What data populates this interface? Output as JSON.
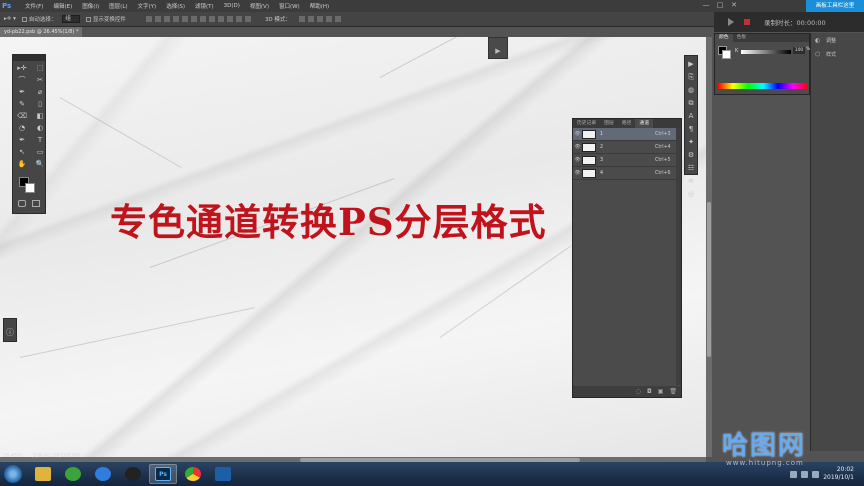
{
  "app": {
    "logo": "Ps",
    "banner": "画板工具栏这里"
  },
  "menu": [
    "文件(F)",
    "编辑(E)",
    "图像(I)",
    "图层(L)",
    "文字(Y)",
    "选择(S)",
    "滤镜(T)",
    "3D(D)",
    "视图(V)",
    "窗口(W)",
    "帮助(H)"
  ],
  "window_controls": {
    "minimize": "—",
    "maximize": "□",
    "close": "✕"
  },
  "options": {
    "auto_select_label": "自动选择：",
    "auto_select_value": "组",
    "show_transform_label": "显示变换控件",
    "mode_3d": "3D 模式："
  },
  "recorder": {
    "label": "录制时长：00:00:00"
  },
  "document": {
    "tab_title": "yd-pb22.psb @ 26.45%(1/8) * ×"
  },
  "canvas": {
    "headline": "专色通道转换PS分层格式",
    "cursor": "↔"
  },
  "status": {
    "zoom": "26.45%",
    "doc": "文档:40.2M/168.8M"
  },
  "tools": [
    "▸✛",
    "⬚",
    "⌒",
    "✂",
    "✒",
    "⌀",
    "✎",
    "▯",
    "⌫",
    "◧",
    "◔",
    "◐",
    "✒",
    "T",
    "↖",
    "▭",
    "✋",
    "🔍"
  ],
  "side_strip": [
    "▶",
    "⎘",
    "◍",
    "⧉",
    "A",
    "¶",
    "✦",
    "⚙",
    "☷",
    "≋",
    "◎"
  ],
  "channels": {
    "tabs": [
      "历史记录",
      "图层",
      "路径",
      "通道"
    ],
    "active_tab": "通道",
    "rows": [
      {
        "name": "1",
        "key": "Ctrl+3",
        "selected": true
      },
      {
        "name": "2",
        "key": "Ctrl+4",
        "selected": false
      },
      {
        "name": "3",
        "key": "Ctrl+5",
        "selected": false
      },
      {
        "name": "4",
        "key": "Ctrl+6",
        "selected": false
      }
    ],
    "footer_icons": [
      "◌",
      "◘",
      "▣",
      "🗑"
    ]
  },
  "color_panel": {
    "tabs": [
      "颜色",
      "色板"
    ],
    "channel_label": "K",
    "value": "100",
    "unit": "%"
  },
  "right_column": [
    {
      "icon": "◐",
      "label": "调整"
    },
    {
      "icon": "⬡",
      "label": "样式"
    }
  ],
  "taskbar": {
    "apps": [
      "文件夹",
      "360",
      "微云",
      "QQ",
      "Ps",
      "Chrome",
      "录屏"
    ],
    "tray_time": "20:02",
    "tray_date": "2019/10/1"
  },
  "watermark": {
    "big": "哈图网",
    "small": "www.hitupng.com"
  }
}
